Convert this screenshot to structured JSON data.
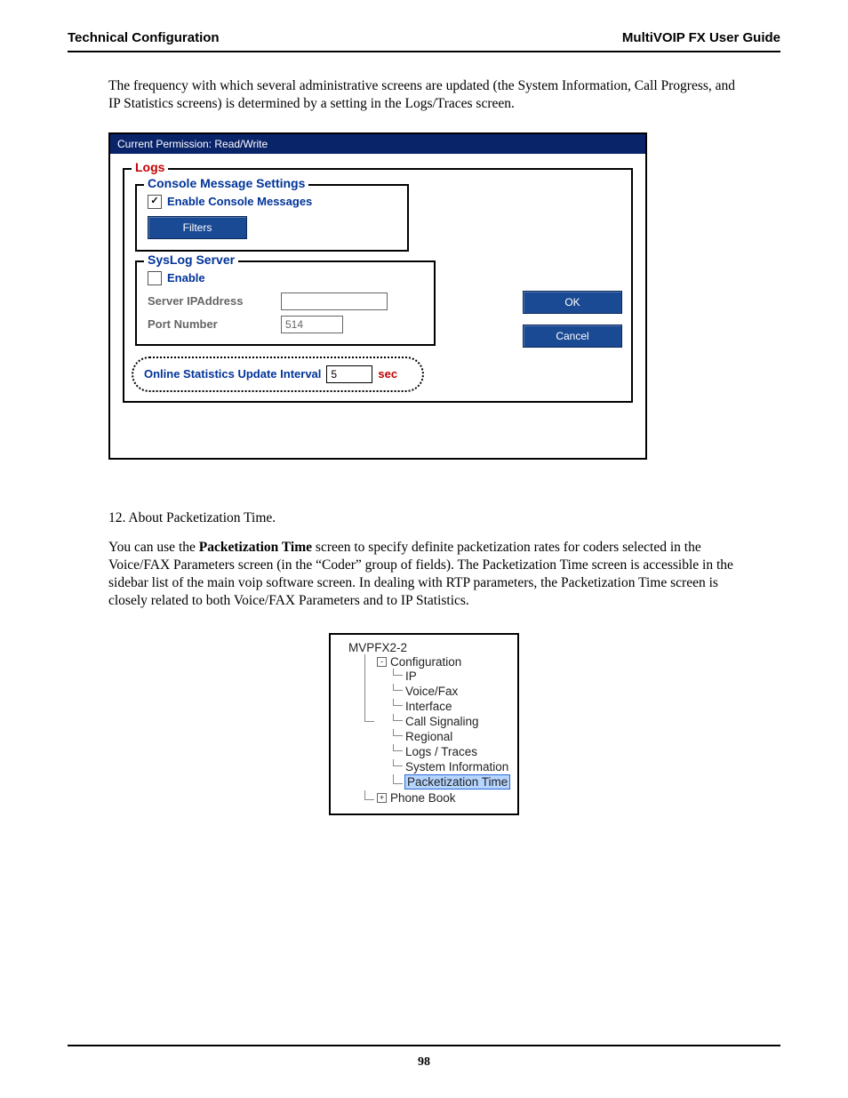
{
  "header": {
    "left": "Technical Configuration",
    "right": "MultiVOIP FX User Guide"
  },
  "para1": "The frequency with which several administrative screens are updated (the System Information, Call Progress, and IP Statistics screens) is determined by a setting in the Logs/Traces screen.",
  "dialog": {
    "title": "Current Permission:  Read/Write",
    "logs_legend": "Logs",
    "console_legend": "Console Message Settings",
    "enable_console": "Enable Console Messages",
    "filters_btn": "Filters",
    "syslog_legend": "SysLog Server",
    "enable_syslog": "Enable",
    "ip_label": "Server IPAddress",
    "ip_value": "",
    "port_label": "Port Number",
    "port_value": "514",
    "stats_label": "Online Statistics Update   Interval",
    "stats_value": "5",
    "stats_unit": "sec",
    "ok": "OK",
    "cancel": "Cancel"
  },
  "section12": {
    "heading": "12. About Packetization Time.",
    "p1a": "You can use the ",
    "p1b": "Packetization Time",
    "p1c": " screen to specify definite packetization rates for coders selected in the Voice/FAX Parameters screen (in the “Coder” group of fields).  The Packetization Time screen is accessible in the sidebar list of the main voip software screen.  In dealing with RTP parameters, the Packetization Time screen is closely related to both Voice/FAX Parameters and to IP Statistics."
  },
  "tree": {
    "root": "MVPFX2-2",
    "config": "Configuration",
    "items": [
      "IP",
      "Voice/Fax",
      "Interface",
      "Call Signaling",
      "Regional",
      "Logs / Traces",
      "System Information",
      "Packetization Time"
    ],
    "phonebook": "Phone Book"
  },
  "page_number": "98"
}
